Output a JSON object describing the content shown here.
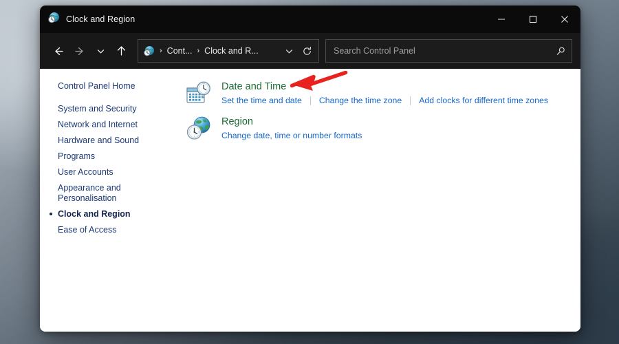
{
  "window": {
    "title": "Clock and Region",
    "title_icon": "clock-globe-icon",
    "controls": {
      "minimize": "minimize-icon",
      "maximize": "maximize-icon",
      "close": "close-icon"
    }
  },
  "toolbar": {
    "back": "back-arrow-icon",
    "forward": "forward-arrow-icon",
    "recent": "chevron-down-icon",
    "up": "up-arrow-icon",
    "address": {
      "icon": "clock-globe-icon",
      "crumbs": [
        "Cont...",
        "Clock and R..."
      ],
      "separator": "›",
      "dropdown": "chevron-down-icon",
      "refresh": "refresh-icon"
    },
    "search": {
      "placeholder": "Search Control Panel",
      "icon": "search-icon",
      "value": ""
    }
  },
  "sidebar": {
    "items": [
      {
        "label": "Control Panel Home",
        "current": false
      },
      {
        "label": "System and Security",
        "current": false
      },
      {
        "label": "Network and Internet",
        "current": false
      },
      {
        "label": "Hardware and Sound",
        "current": false
      },
      {
        "label": "Programs",
        "current": false
      },
      {
        "label": "User Accounts",
        "current": false
      },
      {
        "label": "Appearance and\nPersonalisation",
        "current": false
      },
      {
        "label": "Clock and Region",
        "current": true
      },
      {
        "label": "Ease of Access",
        "current": false
      }
    ]
  },
  "main": {
    "groups": [
      {
        "icon": "calendar-clock-icon",
        "heading": "Date and Time",
        "links": [
          "Set the time and date",
          "Change the time zone",
          "Add clocks for different time zones"
        ]
      },
      {
        "icon": "globe-clock-icon",
        "heading": "Region",
        "links": [
          "Change date, time or number formats"
        ]
      }
    ]
  },
  "annotation": {
    "arrow": "red-arrow-pointing-left",
    "color": "#e8231f",
    "target": "Date and Time"
  },
  "colors": {
    "heading_green": "#1a6b33",
    "link_blue": "#1668cc",
    "sidebar_navy": "#1c3a77",
    "titlebar": "#0b0b0b",
    "toolbar": "#181818"
  }
}
